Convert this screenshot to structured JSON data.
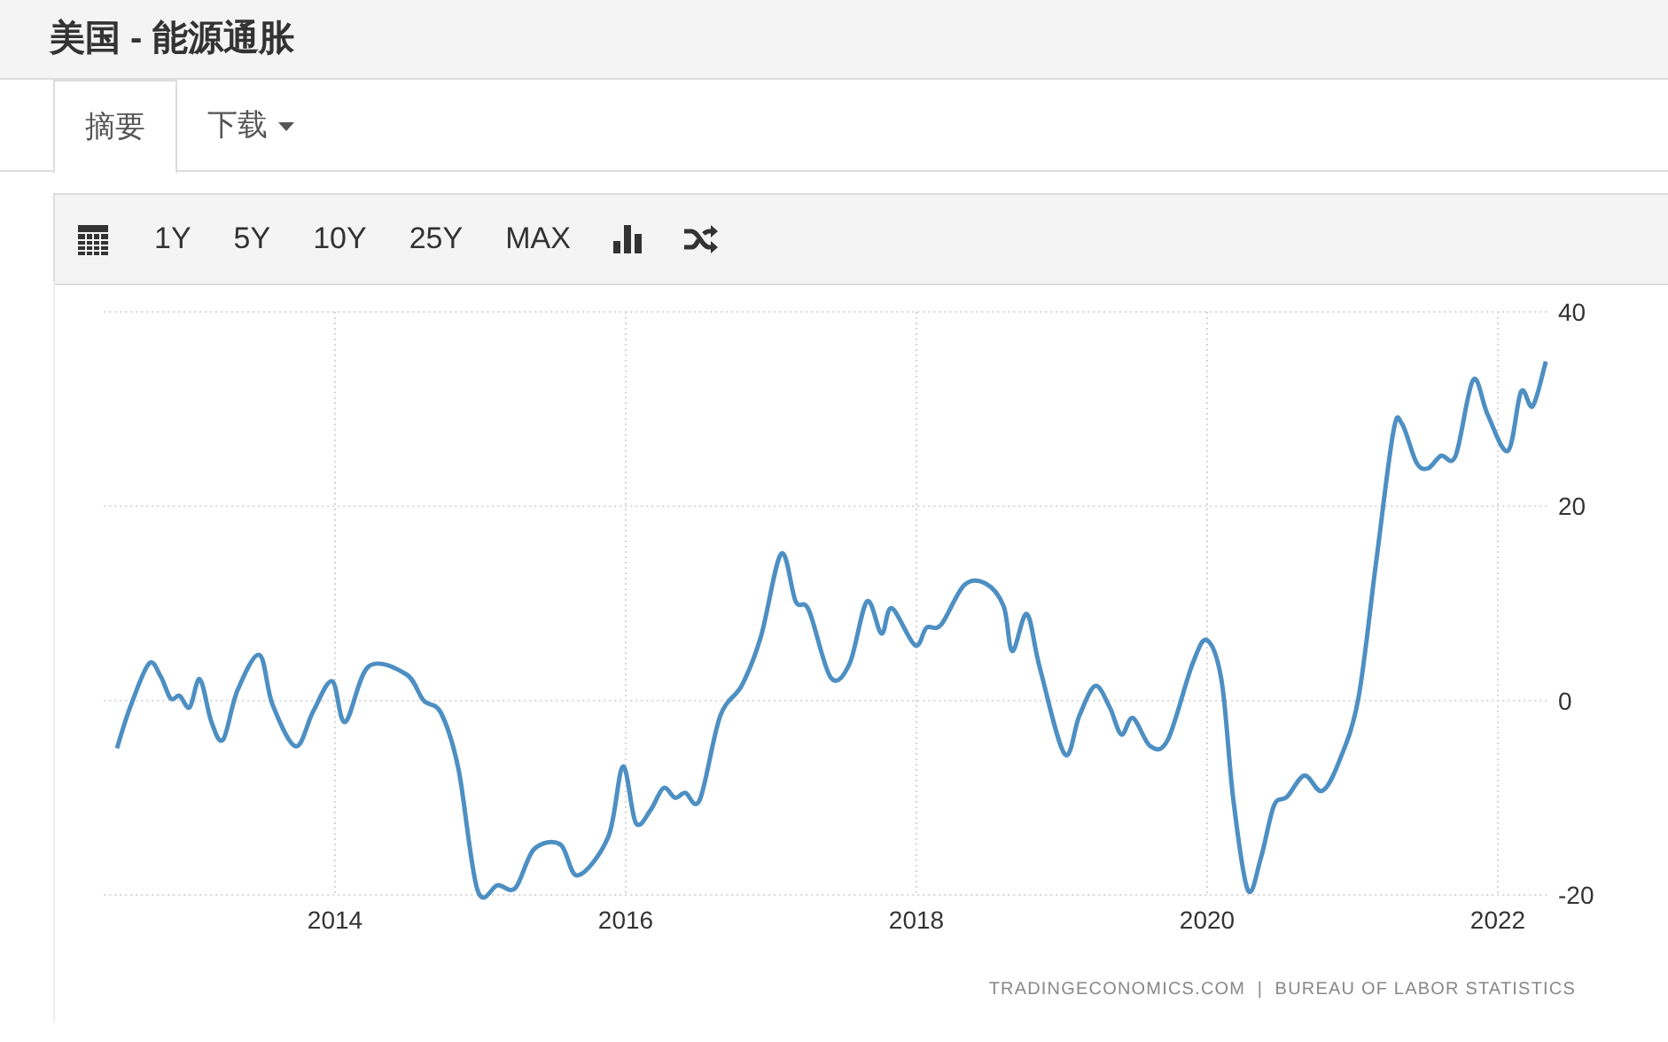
{
  "header": {
    "title": "美国 - 能源通胀"
  },
  "tabs": [
    {
      "label": "摘要",
      "selected": true,
      "has_menu": false
    },
    {
      "label": "下载",
      "selected": false,
      "has_menu": true
    }
  ],
  "toolbar": {
    "ranges": [
      "1Y",
      "5Y",
      "10Y",
      "25Y",
      "MAX"
    ]
  },
  "chart": {
    "source": "TRADINGECONOMICS.COM  |  BUREAU OF LABOR STATISTICS",
    "chart_data": {
      "type": "line",
      "grid": true,
      "xlim": [
        2012.41,
        2022.35
      ],
      "ylim": [
        -20,
        40
      ],
      "yticks": [
        -20,
        0,
        20,
        40
      ],
      "xticks": [
        2014,
        2016,
        2018,
        2020,
        2022
      ],
      "x": [
        2012.5,
        2012.59,
        2012.72,
        2012.8,
        2012.87,
        2012.93,
        2013.0,
        2013.07,
        2013.15,
        2013.23,
        2013.33,
        2013.48,
        2013.57,
        2013.73,
        2013.85,
        2013.98,
        2014.07,
        2014.23,
        2014.49,
        2014.61,
        2014.73,
        2014.85,
        2014.98,
        2015.12,
        2015.24,
        2015.37,
        2015.55,
        2015.67,
        2015.88,
        2015.98,
        2016.07,
        2016.17,
        2016.26,
        2016.34,
        2016.41,
        2016.51,
        2016.65,
        2016.8,
        2016.93,
        2017.07,
        2017.17,
        2017.26,
        2017.41,
        2017.54,
        2017.66,
        2017.76,
        2017.83,
        2017.99,
        2018.07,
        2018.17,
        2018.33,
        2018.48,
        2018.6,
        2018.66,
        2018.76,
        2018.85,
        2019.02,
        2019.12,
        2019.23,
        2019.33,
        2019.41,
        2019.49,
        2019.61,
        2019.73,
        2019.9,
        2020.0,
        2020.1,
        2020.18,
        2020.28,
        2020.37,
        2020.46,
        2020.55,
        2020.67,
        2020.79,
        2020.91,
        2021.04,
        2021.16,
        2021.28,
        2021.34,
        2021.44,
        2021.52,
        2021.61,
        2021.71,
        2021.83,
        2021.93,
        2022.07,
        2022.16,
        2022.24,
        2022.33
      ],
      "series": [
        {
          "color": "#4d8fc3",
          "values": [
            -4.9,
            -0.7,
            3.8,
            2.5,
            0.2,
            0.5,
            -0.7,
            2.2,
            -2.2,
            -4,
            1.1,
            4.7,
            -0.4,
            -4.7,
            -1.1,
            2,
            -2.2,
            3.5,
            2.7,
            0,
            -1.3,
            -7.1,
            -19.5,
            -19,
            -19.3,
            -15.3,
            -14.8,
            -18,
            -14,
            -6.8,
            -12.6,
            -11.3,
            -9,
            -10,
            -9.5,
            -10.2,
            -1.6,
            1.6,
            6.6,
            15.1,
            10.2,
            9.3,
            2.4,
            3.8,
            10.2,
            6.9,
            9.5,
            5.7,
            7.5,
            7.8,
            11.9,
            12,
            9.7,
            5.1,
            8.9,
            3.3,
            -5.5,
            -1.6,
            1.5,
            -0.7,
            -3.5,
            -1.8,
            -4.7,
            -4,
            3.8,
            6.2,
            2,
            -10.2,
            -19.5,
            -16.2,
            -10.8,
            -9.9,
            -7.7,
            -9.3,
            -6.2,
            0.2,
            13.9,
            27.6,
            28.5,
            24.5,
            23.9,
            25.2,
            25.2,
            33,
            29.4,
            25.7,
            31.8,
            30.3,
            34.9
          ]
        }
      ]
    }
  }
}
